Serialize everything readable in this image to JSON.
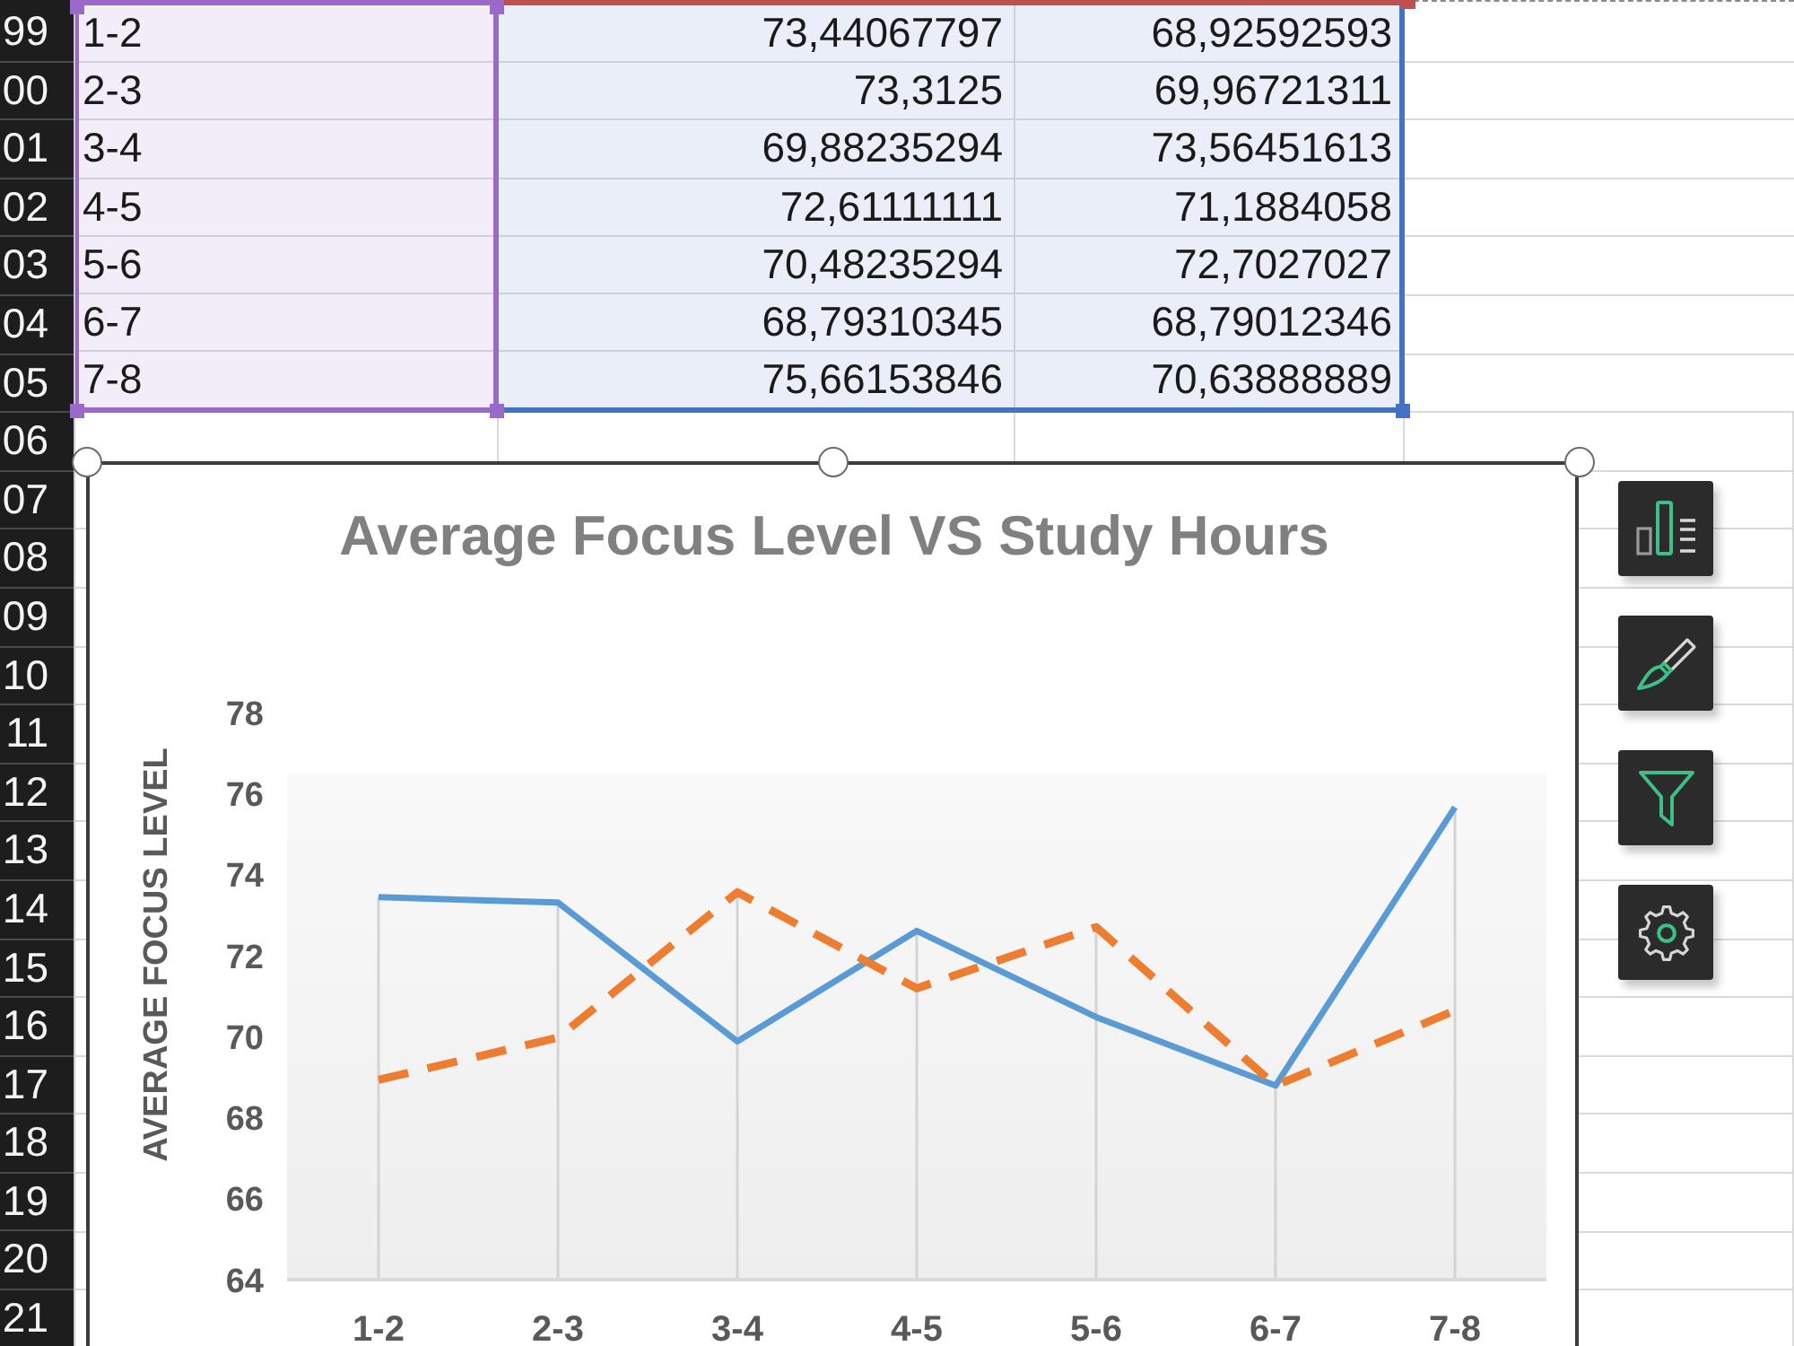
{
  "row_headers": [
    "99",
    "00",
    "01",
    "02",
    "03",
    "04",
    "05",
    "06",
    "07",
    "08",
    "09",
    "10",
    "11",
    "12",
    "13",
    "14",
    "15",
    "16",
    "17",
    "18",
    "19",
    "20",
    "21"
  ],
  "table": {
    "ranges": [
      {
        "kind": "categories",
        "color": "#9b69c9"
      },
      {
        "kind": "series_names",
        "color": "#c0504d"
      },
      {
        "kind": "values",
        "color": "#4472c4"
      }
    ],
    "rows": [
      {
        "category": "1-2",
        "values": [
          "73,44067797",
          "68,92592593"
        ]
      },
      {
        "category": "2-3",
        "values": [
          "73,3125",
          "69,96721311"
        ]
      },
      {
        "category": "3-4",
        "values": [
          "69,88235294",
          "73,56451613"
        ]
      },
      {
        "category": "4-5",
        "values": [
          "72,61111111",
          "71,1884058"
        ]
      },
      {
        "category": "5-6",
        "values": [
          "70,48235294",
          "72,7027027"
        ]
      },
      {
        "category": "6-7",
        "values": [
          "68,79310345",
          "68,79012346"
        ]
      },
      {
        "category": "7-8",
        "values": [
          "75,66153846",
          "70,63888889"
        ]
      }
    ]
  },
  "chart": {
    "selected": true,
    "chart_data": {
      "type": "line",
      "title": "Average Focus Level VS Study Hours",
      "ylabel": "AVERAGE FOCUS LEVEL",
      "categories": [
        "1-2",
        "2-3",
        "3-4",
        "4-5",
        "5-6",
        "6-7",
        "7-8"
      ],
      "series": [
        {
          "color": "#5b9bd5",
          "line_style": "solid",
          "values": [
            73.44,
            73.31,
            69.88,
            72.61,
            70.48,
            68.79,
            75.66
          ]
        },
        {
          "color": "#ed7d31",
          "line_style": "dashed",
          "values": [
            68.93,
            69.97,
            73.56,
            71.19,
            72.7,
            68.79,
            70.64
          ]
        }
      ],
      "ylim": [
        64,
        78
      ],
      "yticks": [
        64,
        66,
        68,
        70,
        72,
        74,
        76,
        78
      ]
    }
  },
  "chart_tools": [
    {
      "kind": "elements"
    },
    {
      "kind": "styles"
    },
    {
      "kind": "filters"
    },
    {
      "kind": "settings"
    }
  ]
}
